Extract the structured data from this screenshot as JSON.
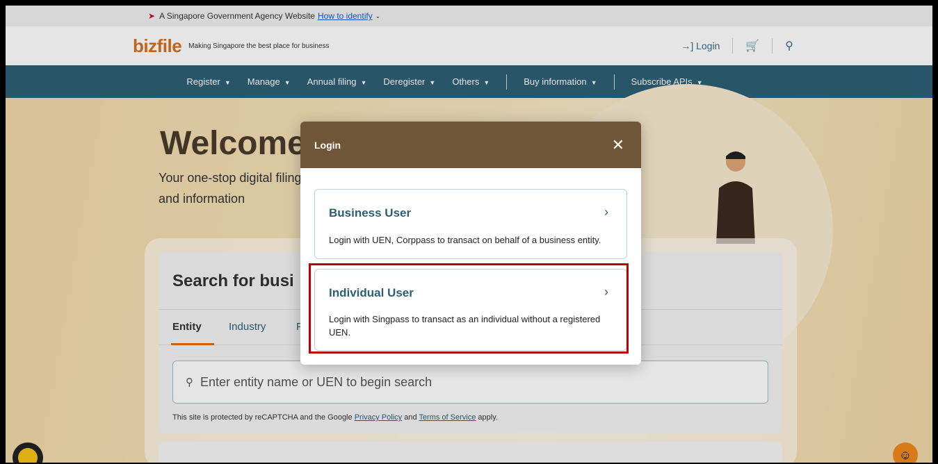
{
  "masthead": {
    "text": "A Singapore Government Agency Website",
    "link": "How to identify"
  },
  "header": {
    "logo": "bizfile",
    "tagline": "Making Singapore the best place for business",
    "login": "Login"
  },
  "nav": {
    "items": [
      "Register",
      "Manage",
      "Annual filing",
      "Deregister",
      "Others",
      "Buy information",
      "Subscribe APIs"
    ]
  },
  "hero": {
    "title": "Welcome",
    "subtitle": "Your one-stop digital filing and information"
  },
  "search": {
    "title": "Search for busi",
    "tabs": [
      "Entity",
      "Industry",
      "F"
    ],
    "placeholder": "Enter entity name or UEN to begin search",
    "recaptcha_prefix": "This site is protected by reCAPTCHA and the Google",
    "privacy": "Privacy Policy",
    "and": "and",
    "terms": "Terms of Service",
    "apply": "apply."
  },
  "modal": {
    "title": "Login",
    "options": [
      {
        "title": "Business User",
        "desc": "Login with UEN, Corppass to transact on behalf of a business entity."
      },
      {
        "title": "Individual User",
        "desc": "Login with Singpass to transact as an individual without a registered UEN."
      }
    ]
  },
  "colors": {
    "nav": "#2d5f74",
    "modal_header": "#6f5639",
    "accent": "#d86f1b",
    "highlight": "#c00000"
  }
}
